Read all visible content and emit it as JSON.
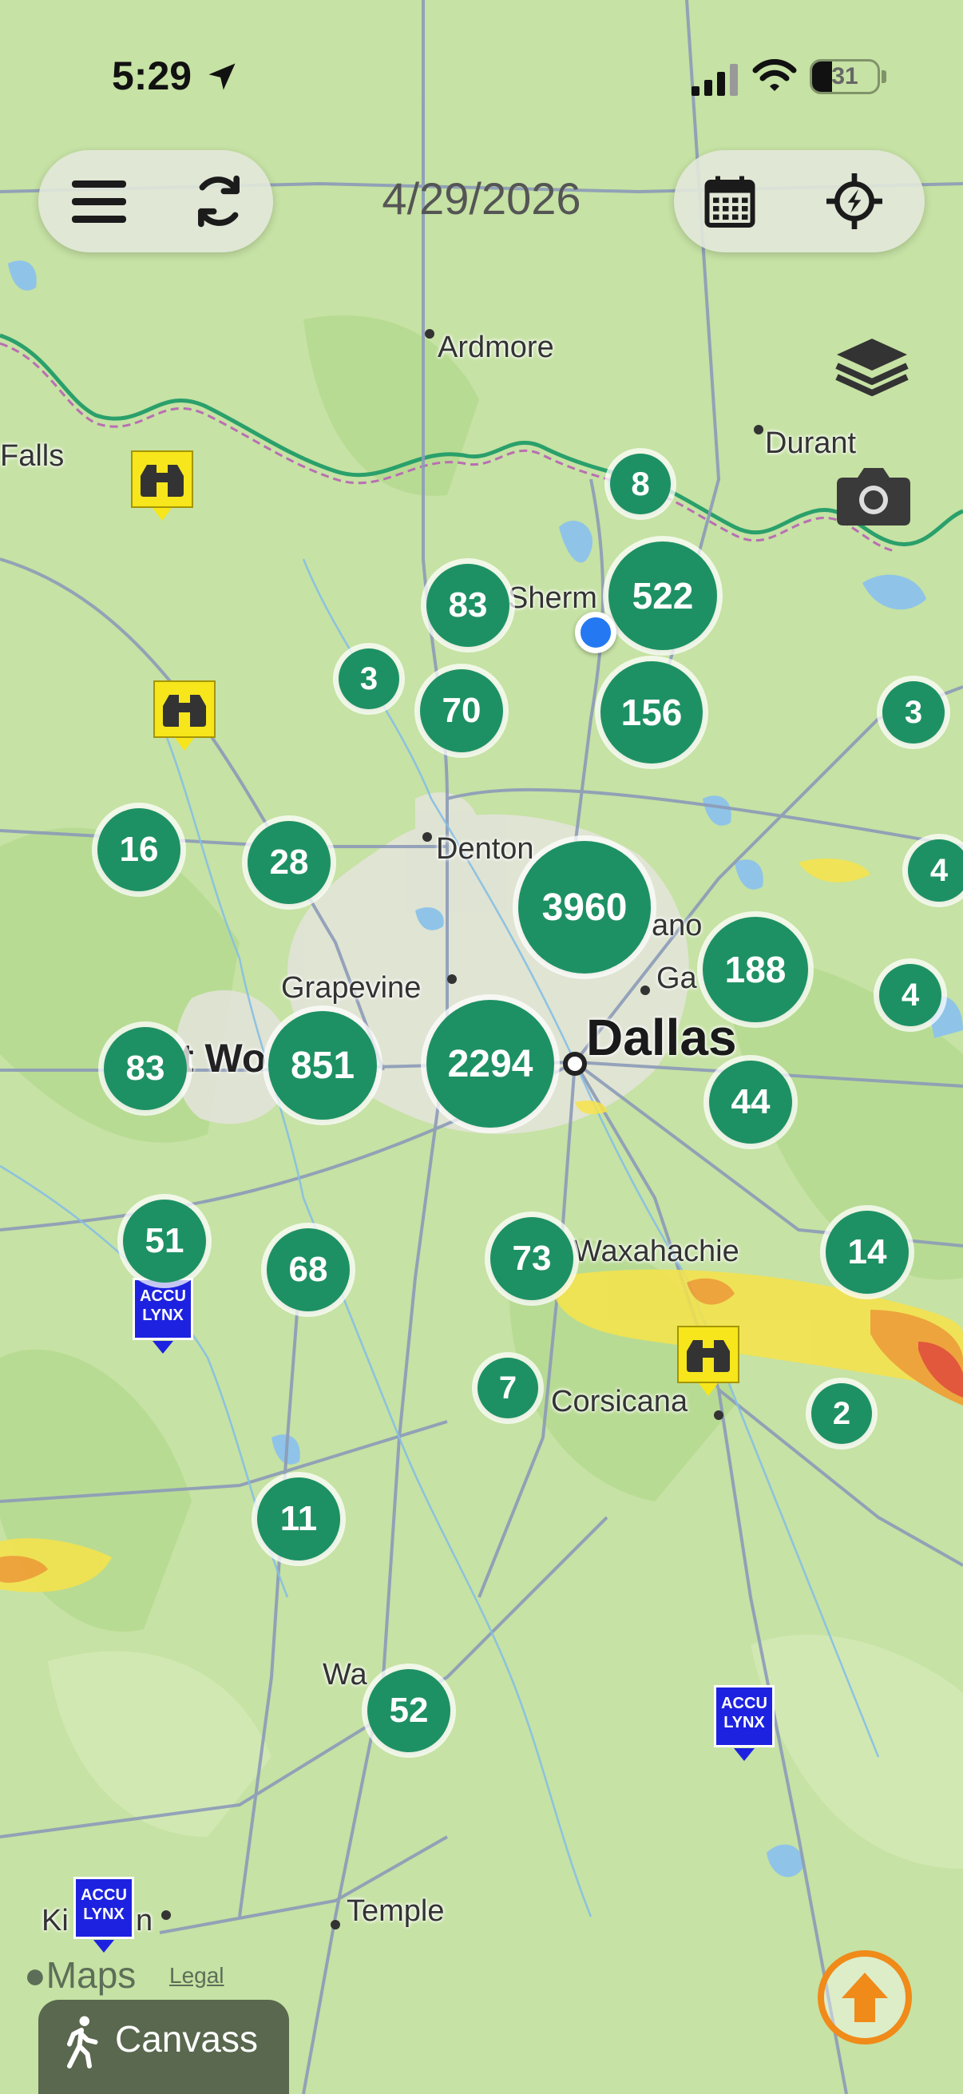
{
  "status_bar": {
    "time": "5:29",
    "battery": "31",
    "battery_level": 0.31
  },
  "toolbar": {
    "date": "4/29/2026",
    "menu_icon": "menu-icon",
    "refresh_icon": "refresh-icon",
    "calendar_icon": "calendar-icon",
    "location_icon": "location-crosshair-icon"
  },
  "map": {
    "cities": [
      "Ardmore",
      "Durant",
      "Falls",
      "Sherm",
      "Denton",
      "Grapevine",
      "ano",
      "Ga",
      "Dallas",
      "t Wo",
      "Waxahachie",
      "Corsicana",
      "Wa",
      "Temple",
      "Ki",
      "n"
    ],
    "clusters": [
      "8",
      "522",
      "83",
      "3",
      "70",
      "156",
      "3",
      "16",
      "28",
      "3960",
      "4",
      "188",
      "4",
      "83",
      "851",
      "2294",
      "44",
      "51",
      "68",
      "73",
      "14",
      "7",
      "2",
      "11",
      "52"
    ],
    "accu_label_1": "ACCU",
    "accu_label_2": "LYNX",
    "heat_colors": [
      "#f7e34a",
      "#f49a2b",
      "#e8402a"
    ]
  },
  "footer": {
    "maps_label": "Maps",
    "legal": "Legal",
    "canvass": "Canvass"
  }
}
